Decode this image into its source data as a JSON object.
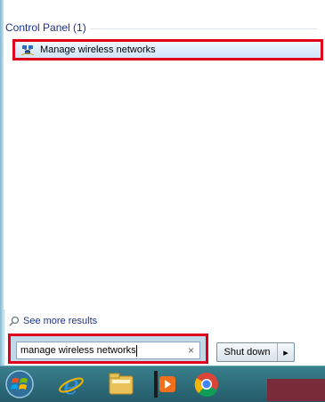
{
  "search_results": {
    "group_header": "Control Panel (1)",
    "items": [
      {
        "label": "Manage wireless networks",
        "icon": "wireless-network-icon"
      }
    ]
  },
  "see_more": {
    "label": "See more results",
    "icon": "search-icon"
  },
  "search": {
    "value": "manage wireless networks",
    "clear_icon": "×"
  },
  "shutdown": {
    "label": "Shut down",
    "arrow": "▸"
  },
  "taskbar": {
    "items": [
      {
        "name": "start-orb-icon"
      },
      {
        "name": "internet-explorer-icon"
      },
      {
        "name": "file-explorer-icon"
      },
      {
        "name": "media-player-icon"
      },
      {
        "name": "chrome-icon"
      }
    ]
  },
  "colors": {
    "highlight_border": "#e0001b",
    "link_text": "#1e3287"
  }
}
